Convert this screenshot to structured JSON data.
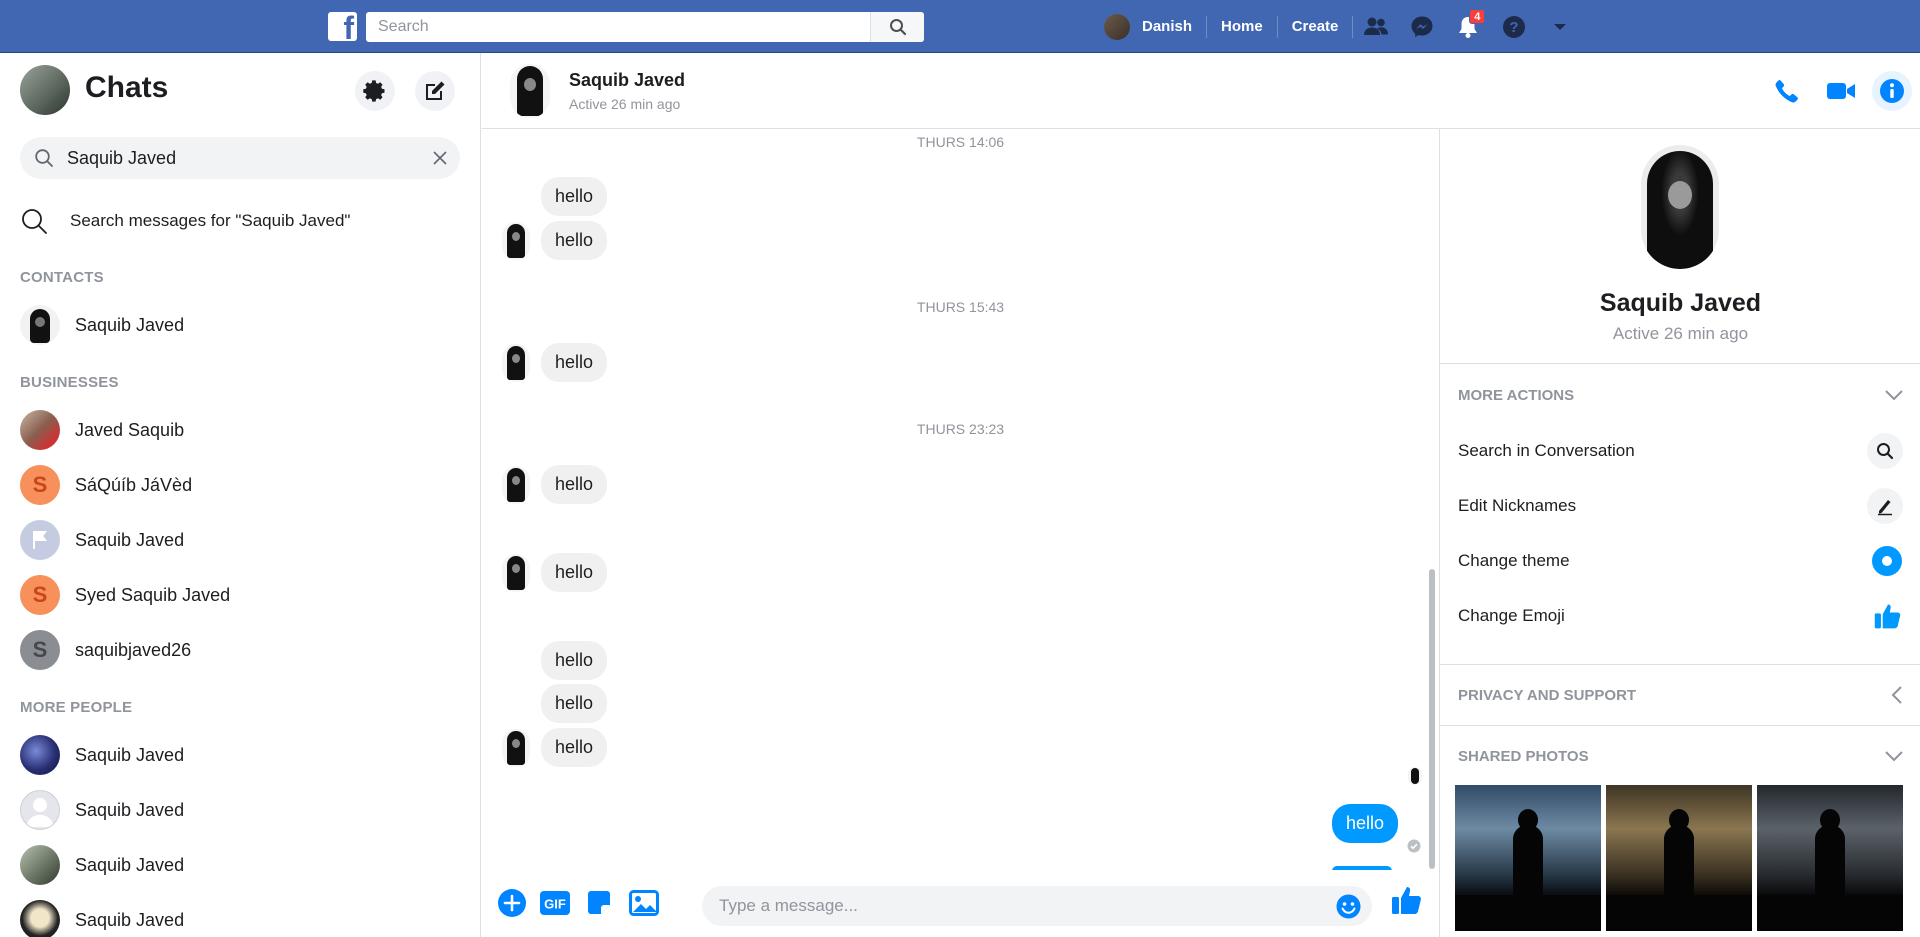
{
  "topbar": {
    "logo": "f",
    "search_placeholder": "Search",
    "user_name": "Danish",
    "home": "Home",
    "create": "Create",
    "notification_count": "4",
    "icons": [
      "friends-icon",
      "messenger-icon",
      "bell-icon",
      "help-icon",
      "caret-down-icon"
    ],
    "color": "#4267b2"
  },
  "left": {
    "title": "Chats",
    "search_value": "Saquib Javed",
    "search_messages": "Search messages for \"Saquib Javed\"",
    "contacts_label": "CONTACTS",
    "contacts": [
      {
        "name": "Saquib Javed"
      }
    ],
    "businesses_label": "BUSINESSES",
    "businesses": [
      {
        "name": "Javed Saquib"
      },
      {
        "name": "SáQúíb JáVèd",
        "initial": "S"
      },
      {
        "name": "Saquib Javed"
      },
      {
        "name": "Syed Saquib Javed",
        "initial": "S"
      },
      {
        "name": "saquibjaved26",
        "initial": "S"
      }
    ],
    "more_label": "MORE PEOPLE",
    "more_people": [
      {
        "name": "Saquib Javed"
      },
      {
        "name": "Saquib Javed"
      },
      {
        "name": "Saquib Javed"
      },
      {
        "name": "Saquib Javed"
      }
    ]
  },
  "conversation": {
    "name": "Saquib Javed",
    "status": "Active 26 min ago",
    "timestamps": [
      "THURS 14:06",
      "THURS 15:43",
      "THURS 23:23"
    ],
    "messages": [
      "hello",
      "hello",
      "hello",
      "hello",
      "hello",
      "hello",
      "hello",
      "hello",
      "hello"
    ],
    "my_message": "hello",
    "composer_placeholder": "Type a message...",
    "gif_label": "GIF",
    "accent": "#0099ff"
  },
  "info": {
    "name": "Saquib Javed",
    "status": "Active 26 min ago",
    "more_actions": "MORE ACTIONS",
    "actions": [
      "Search in Conversation",
      "Edit Nicknames",
      "Change theme",
      "Change Emoji"
    ],
    "privacy": "PRIVACY AND SUPPORT",
    "shared_photos": "SHARED PHOTOS"
  }
}
